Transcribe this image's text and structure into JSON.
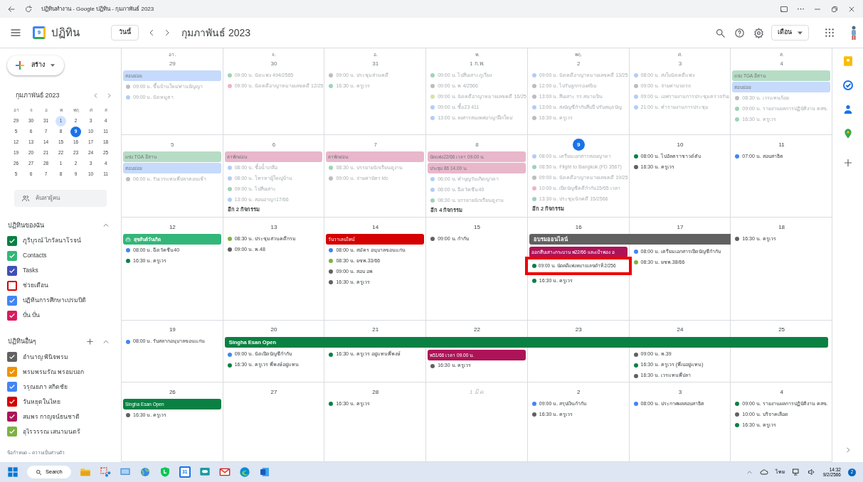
{
  "browser": {
    "title": "ปฏิทินทำงาน - Google ปฏิทิน - กุมภาพันธ์ 2023",
    "more": "···"
  },
  "header": {
    "logo_day": "9",
    "app_name": "ปฏิทิน",
    "today_button": "วันนี้",
    "month_title": "กุมภาพันธ์ 2023",
    "view_selector": "เดือน"
  },
  "sidebar": {
    "create_button": "สร้าง",
    "mini_calendar": {
      "title": "กุมภาพันธ์ 2023",
      "weekdays": [
        "อา",
        "จ",
        "อ",
        "พ",
        "พฤ",
        "ศ",
        "ส"
      ],
      "weeks": [
        [
          {
            "day": "29",
            "selected": false,
            "today": false
          },
          {
            "day": "30",
            "selected": false,
            "today": false
          },
          {
            "day": "31",
            "selected": false,
            "today": false
          },
          {
            "day": "1",
            "selected": true,
            "today": false
          },
          {
            "day": "2",
            "selected": false,
            "today": false
          },
          {
            "day": "3",
            "selected": false,
            "today": false
          },
          {
            "day": "4",
            "selected": false,
            "today": false
          }
        ],
        [
          {
            "day": "5",
            "selected": false,
            "today": false
          },
          {
            "day": "6",
            "selected": false,
            "today": false
          },
          {
            "day": "7",
            "selected": false,
            "today": false
          },
          {
            "day": "8",
            "selected": false,
            "today": false
          },
          {
            "day": "9",
            "selected": false,
            "today": true
          },
          {
            "day": "10",
            "selected": false,
            "today": false
          },
          {
            "day": "11",
            "selected": false,
            "today": false
          }
        ],
        [
          {
            "day": "12",
            "selected": false,
            "today": false
          },
          {
            "day": "13",
            "selected": false,
            "today": false
          },
          {
            "day": "14",
            "selected": false,
            "today": false
          },
          {
            "day": "15",
            "selected": false,
            "today": false
          },
          {
            "day": "16",
            "selected": false,
            "today": false
          },
          {
            "day": "17",
            "selected": false,
            "today": false
          },
          {
            "day": "18",
            "selected": false,
            "today": false
          }
        ],
        [
          {
            "day": "19",
            "selected": false,
            "today": false
          },
          {
            "day": "20",
            "selected": false,
            "today": false
          },
          {
            "day": "21",
            "selected": false,
            "today": false
          },
          {
            "day": "22",
            "selected": false,
            "today": false
          },
          {
            "day": "23",
            "selected": false,
            "today": false
          },
          {
            "day": "24",
            "selected": false,
            "today": false
          },
          {
            "day": "25",
            "selected": false,
            "today": false
          }
        ],
        [
          {
            "day": "26",
            "selected": false,
            "today": false
          },
          {
            "day": "27",
            "selected": false,
            "today": false
          },
          {
            "day": "28",
            "selected": false,
            "today": false
          },
          {
            "day": "1",
            "selected": false,
            "today": false
          },
          {
            "day": "2",
            "selected": false,
            "today": false
          },
          {
            "day": "3",
            "selected": false,
            "today": false
          },
          {
            "day": "4",
            "selected": false,
            "today": false
          }
        ],
        [
          {
            "day": "5",
            "selected": false,
            "today": false
          },
          {
            "day": "6",
            "selected": false,
            "today": false
          },
          {
            "day": "7",
            "selected": false,
            "today": false
          },
          {
            "day": "8",
            "selected": false,
            "today": false
          },
          {
            "day": "9",
            "selected": false,
            "today": false
          },
          {
            "day": "10",
            "selected": false,
            "today": false
          },
          {
            "day": "11",
            "selected": false,
            "today": false
          }
        ]
      ]
    },
    "search_people": {
      "placeholder": "ค้นหาผู้คน"
    },
    "my_calendars": {
      "title": "ปฏิทินของฉัน",
      "items": [
        {
          "name": "ภูริบุรณ์ ไกวัลนาโรจน์",
          "checked": true,
          "color": "#0b8043"
        },
        {
          "name": "Contacts",
          "checked": true,
          "color": "#33b679"
        },
        {
          "name": "Tasks",
          "checked": true,
          "color": "#3f51b5"
        },
        {
          "name": "ช่วยเตือน",
          "checked": false,
          "color": "#d50000"
        },
        {
          "name": "ปฏิทินการศึกษาเปรมปิติ",
          "checked": true,
          "color": "#4285f4"
        },
        {
          "name": "ปั่น ปั่น",
          "checked": true,
          "color": "#d81b60"
        }
      ]
    },
    "other_calendars": {
      "title": "ปฏิทินอื่นๆ",
      "items": [
        {
          "name": "อำนาญ พินิจพรม",
          "checked": true,
          "color": "#616161"
        },
        {
          "name": "พรมพรมรัณ พรอมบอก",
          "checked": true,
          "color": "#f09300"
        },
        {
          "name": "วรุณยภา สกิดชัย",
          "checked": true,
          "color": "#4285f4"
        },
        {
          "name": "วันหยุดในไทย",
          "checked": true,
          "color": "#d50000"
        },
        {
          "name": "สมพร กาญจน์ธนชาติ",
          "checked": true,
          "color": "#ad1457"
        },
        {
          "name": "อุไรวรรณ เสนามนตรี",
          "checked": true,
          "color": "#7cb342"
        }
      ]
    },
    "footer": "ข้อกำหนด – ความเป็นส่วนตัว"
  },
  "month_grid": {
    "weekday_labels": [
      "อา.",
      "จ.",
      "อ.",
      "พ.",
      "พฤ.",
      "ศ.",
      "ส."
    ],
    "weeks": [
      {
        "days": [
          {
            "label": "29",
            "past": true,
            "today": false,
            "other_month": false,
            "events": [
              {
                "kind": "chip",
                "title": "สอบย่อย",
                "color": "#c6dafc"
              },
              {
                "kind": "timed",
                "text": "09:00 น. ขึ้นบ้านใหม่ท่านปัญญา",
                "color": "#bdbdbd"
              },
              {
                "kind": "timed",
                "text": "09:00 น. นัดหมูตา",
                "color": "#b3cdf7"
              }
            ]
          },
          {
            "label": "30",
            "past": true,
            "today": false,
            "other_month": false,
            "events": [
              {
                "kind": "timed",
                "text": "09:00 น. นัดแพ่ง 494/2565",
                "color": "#9fd3b5"
              },
              {
                "kind": "timed",
                "text": "09:00 น. นัดคดีอาญาหมายเลขคดี 12/25",
                "color": "#efb3c8"
              }
            ]
          },
          {
            "label": "31",
            "past": true,
            "today": false,
            "other_month": false,
            "events": [
              {
                "kind": "timed",
                "text": "09:00 น. ประชุมส่วนคดี",
                "color": "#bdbdbd"
              },
              {
                "kind": "timed",
                "text": "16:30 น. ครูเวร",
                "color": "#9fd3b5"
              }
            ]
          },
          {
            "label": "1 ก.พ.",
            "past": true,
            "today": false,
            "other_month": false,
            "events": [
              {
                "kind": "timed",
                "text": "09:00 น. ไปสืบเสาะภูเวียง",
                "color": "#9fd3b5"
              },
              {
                "kind": "timed",
                "text": "09:00 น. พ 4/2566",
                "color": "#bdbdbd"
              },
              {
                "kind": "timed",
                "text": "09:00 น. นัดคดีอาญาหมายเลขคดี 16/25",
                "color": "#d4e3a8"
              },
              {
                "kind": "timed",
                "text": "09:00 น. ซื้อ23 411",
                "color": "#b3cdf7"
              },
              {
                "kind": "timed",
                "text": "13:00 น. ลงสารสนเทศอาญาฝึกใหม่",
                "color": "#b3cdf7"
              }
            ]
          },
          {
            "label": "2",
            "past": true,
            "today": false,
            "other_month": false,
            "events": [
              {
                "kind": "timed",
                "text": "09:00 น. นัดคดีอาญาหมายเลขคดี 13/25",
                "color": "#b3cdf7"
              },
              {
                "kind": "timed",
                "text": "12:00 น. ไปรับลูกกรองสนิม",
                "color": "#bdbdbd"
              },
              {
                "kind": "timed",
                "text": "13:00 น. สืบเสาะ รร.สนามบิน",
                "color": "#bdbdbd"
              },
              {
                "kind": "timed",
                "text": "13:00 น. ส่งบัญชีกำกับสืบปี ปรับสมุดบัญ",
                "color": "#b3cdf7"
              },
              {
                "kind": "timed",
                "text": "16:30 น. ครูเวร",
                "color": "#bdbdbd"
              }
            ]
          },
          {
            "label": "3",
            "past": true,
            "today": false,
            "other_month": false,
            "events": [
              {
                "kind": "timed",
                "text": "08:00 น. ส่งใบนัดคดีแพ่ง",
                "color": "#b3cdf7"
              },
              {
                "kind": "timed",
                "text": "09:00 น. จ่ายค่าบวดรถ",
                "color": "#bdbdbd"
              },
              {
                "kind": "timed",
                "text": "09:00 น. เอฟรายงานการประชุมตรวจรับเ",
                "color": "#b3cdf7"
              },
              {
                "kind": "timed",
                "text": "21:00 น. ทำรายงานการประชุม",
                "color": "#b3cdf7"
              }
            ]
          },
          {
            "label": "4",
            "past": true,
            "today": false,
            "other_month": false,
            "events": [
              {
                "kind": "chip",
                "title": "แข่ง TGA อีสาน",
                "color": "#b7dcc5"
              },
              {
                "kind": "chip",
                "title": "สอบย่อย",
                "color": "#c6dafc"
              },
              {
                "kind": "timed",
                "text": "08:30 น. เวรแทนก้อย",
                "color": "#bdbdbd"
              },
              {
                "kind": "timed",
                "text": "09:00 น. รายงานผลการปฏิบัติงาน คสข.",
                "color": "#9fd3b5"
              },
              {
                "kind": "timed",
                "text": "16:30 น. ครูเวร",
                "color": "#9fd3b5"
              }
            ]
          }
        ]
      },
      {
        "days": [
          {
            "label": "5",
            "past": true,
            "today": false,
            "other_month": false,
            "events": [
              {
                "kind": "chip",
                "title": "แข่ง TGA อีสาน",
                "color": "#b7dcc5"
              },
              {
                "kind": "chip",
                "title": "สอบย่อย",
                "color": "#c6dafc"
              },
              {
                "kind": "timed",
                "text": "06:00 น. รับเวรแทนพี่ปลาตอนเช้า",
                "color": "#bdbdbd"
              }
            ]
          },
          {
            "label": "6",
            "past": true,
            "today": false,
            "other_month": false,
            "more": "อีก 2 กิจกรรม",
            "events": [
              {
                "kind": "chip",
                "title": "ลาพักผ่อน",
                "color": "#e8b7cb"
              },
              {
                "kind": "timed",
                "text": "08:00 น. ซื้อน้ำเกลือ",
                "color": "#b3cdf7"
              },
              {
                "kind": "timed",
                "text": "08:00 น. โทรหาผู้ใหญ่บ้าน",
                "color": "#b3cdf7"
              },
              {
                "kind": "timed",
                "text": "09:00 น. ไปสืบเสาะ",
                "color": "#9fd3b5"
              },
              {
                "kind": "timed",
                "text": "13:00 น. สอบอาญา17/66",
                "color": "#b3cdf7"
              }
            ]
          },
          {
            "label": "7",
            "past": true,
            "today": false,
            "other_month": false,
            "events": [
              {
                "kind": "chip",
                "title": "ลาพักผ่อน",
                "color": "#e8b7cb"
              },
              {
                "kind": "timed",
                "text": "08:30 น. บรรยายนักเรียนดูงาน",
                "color": "#9fd3b5"
              },
              {
                "kind": "timed",
                "text": "09:00 น. จ่ายค่าบัตร ktc",
                "color": "#bdbdbd"
              }
            ]
          },
          {
            "label": "8",
            "past": true,
            "today": false,
            "other_month": false,
            "more": "อีก 4 กิจกรรม",
            "events": [
              {
                "kind": "chip",
                "title": "นัดแพ่ง22/66 เวลา 09.00 น.",
                "color": "#e8b7cb"
              },
              {
                "kind": "chip",
                "title": "ประชุม 86 14.00 น.",
                "color": "#e8b7cb"
              },
              {
                "kind": "timed",
                "text": "06:00 น. ทำบุญวันเกิดญาดา",
                "color": "#b3cdf7"
              },
              {
                "kind": "timed",
                "text": "08:00 น. ฉีดวัคซีน40",
                "color": "#b3cdf7"
              },
              {
                "kind": "timed",
                "text": "08:30 น. บรรยายนักเรียนดูงาน",
                "color": "#9fd3b5"
              }
            ]
          },
          {
            "label": "9",
            "past": false,
            "today": true,
            "other_month": false,
            "more": "อีก 2 กิจกรรม",
            "events": [
              {
                "kind": "done",
                "text": "08:00 น. เตรียมเอกสารสอบญาดา",
                "color": "#b3cdf7"
              },
              {
                "kind": "done",
                "text": "08:50 น. Flight to Bangkok (FD 3567)",
                "color": "#9fd3b5"
              },
              {
                "kind": "done",
                "text": "09:00 น. นัดคดีอาญาหมายเลขคดี 19/25",
                "color": "#bdbdbd"
              },
              {
                "kind": "done",
                "text": "10:00 น. เปิดบัญชีคดีกำกับ15/65 เวลา",
                "color": "#efb3c8"
              },
              {
                "kind": "done",
                "text": "13:30 น. ประชุมนักคดี 15/2566",
                "color": "#9fd3b5"
              }
            ]
          },
          {
            "label": "10",
            "past": false,
            "today": false,
            "other_month": false,
            "events": [
              {
                "kind": "timed",
                "text": "08:00 น. ไปอัลตราซาวด์ตับ",
                "color": "#0b8043"
              },
              {
                "kind": "timed",
                "text": "16:30 น. ครูเวร",
                "color": "#616161"
              }
            ]
          },
          {
            "label": "11",
            "past": false,
            "today": false,
            "other_month": false,
            "events": [
              {
                "kind": "timed",
                "text": "07:00 น. สอบสาธิต",
                "color": "#4285f4"
              }
            ]
          }
        ]
      },
      {
        "days": [
          {
            "label": "12",
            "past": false,
            "today": false,
            "other_month": false,
            "events": [
              {
                "kind": "birthday",
                "title": "สุขสันต์วันเกิด",
                "color": "#33b679"
              },
              {
                "kind": "timed",
                "text": "08:00 น. ฉีดวัคซีน40",
                "color": "#4285f4"
              },
              {
                "kind": "timed",
                "text": "16:30 น. ครูเวร",
                "color": "#0b8043"
              }
            ]
          },
          {
            "label": "13",
            "past": false,
            "today": false,
            "other_month": false,
            "events": [
              {
                "kind": "timed",
                "text": "08:30 น. ประชุมส่วนคดีกรม",
                "color": "#7cb342"
              },
              {
                "kind": "timed",
                "text": "09:00 น. พ.48",
                "color": "#616161"
              }
            ]
          },
          {
            "label": "14",
            "past": false,
            "today": false,
            "other_month": false,
            "events": [
              {
                "kind": "chip",
                "title": "วันวาเลนไทน์",
                "color": "#d50000"
              },
              {
                "kind": "timed",
                "text": "08:00 น. สมัคร อนุบาลขอนแก่น",
                "color": "#4285f4"
              },
              {
                "kind": "timed",
                "text": "08:30 น. ยชพ.33/66",
                "color": "#7cb342"
              },
              {
                "kind": "timed",
                "text": "09:00 น. สอบ อพ",
                "color": "#616161"
              },
              {
                "kind": "timed",
                "text": "16:30 น. ครูเวร",
                "color": "#616161"
              }
            ]
          },
          {
            "label": "15",
            "past": false,
            "today": false,
            "other_month": false,
            "events": [
              {
                "kind": "timed",
                "text": "09:00 น. กำกับ",
                "color": "#616161"
              }
            ]
          },
          {
            "label": "16",
            "past": false,
            "today": false,
            "other_month": false,
            "events": [
              {
                "kind": "span_start",
                "title": "อบรมออนไลน์",
                "color": "#616161"
              },
              {
                "kind": "chip",
                "title": "ออกสืบเสาะกระบวน พ22/66 และเป้าพอง อ",
                "color": "#ad1457"
              },
              {
                "kind": "highlighted",
                "text": "09:00 น. นัดคดีแพ่งหมายเลขดำที่ 2/256",
                "color": "#0b8043"
              },
              {
                "kind": "timed",
                "text": "16:30 น. ครูเวร",
                "color": "#0b8043"
              }
            ]
          },
          {
            "label": "17",
            "past": false,
            "today": false,
            "other_month": false,
            "events": [
              {
                "kind": "span_continue",
                "color": "#616161"
              },
              {
                "kind": "timed",
                "text": "08:00 น. เตรียมเอกสารเปิดบัญชีกำกับ",
                "color": "#4285f4"
              },
              {
                "kind": "timed",
                "text": "08:30 น. ยชพ.38/66",
                "color": "#7cb342"
              }
            ]
          },
          {
            "label": "18",
            "past": false,
            "today": false,
            "other_month": false,
            "events": [
              {
                "kind": "timed",
                "text": "16:30 น. ครูเวร",
                "color": "#616161"
              }
            ]
          }
        ]
      },
      {
        "days": [
          {
            "label": "19",
            "past": false,
            "today": false,
            "other_month": false,
            "events": [
              {
                "kind": "timed",
                "text": "08:00 น. รับสลากอนุบาลขอนแก่น",
                "color": "#4285f4"
              }
            ]
          },
          {
            "label": "20",
            "past": false,
            "today": false,
            "other_month": false,
            "events": [
              {
                "kind": "span_start",
                "title": "Singha Esan Open",
                "color": "#0b8043"
              },
              {
                "kind": "timed",
                "text": "09:00 น. นัดเปิดบัญชีกำกับ",
                "color": "#4285f4"
              },
              {
                "kind": "timed",
                "text": "16:30 น. ครูเวร พี่พงษ์อยู่แทน",
                "color": "#0b8043"
              }
            ]
          },
          {
            "label": "21",
            "past": false,
            "today": false,
            "other_month": false,
            "events": [
              {
                "kind": "span_continue",
                "color": "#0b8043"
              },
              {
                "kind": "timed",
                "text": "16:30 น. ครูเวร อยู่แทนพี่พงษ์",
                "color": "#0b8043"
              }
            ]
          },
          {
            "label": "22",
            "past": false,
            "today": false,
            "other_month": false,
            "events": [
              {
                "kind": "span_continue",
                "color": "#0b8043"
              },
              {
                "kind": "chip",
                "title": "พ51/66 เวลา 09.00 น.",
                "color": "#ad1457"
              },
              {
                "kind": "timed",
                "text": "16:30 น. ครูเวร",
                "color": "#616161"
              }
            ]
          },
          {
            "label": "23",
            "past": false,
            "today": false,
            "other_month": false,
            "events": [
              {
                "kind": "span_continue",
                "color": "#0b8043"
              }
            ]
          },
          {
            "label": "24",
            "past": false,
            "today": false,
            "other_month": false,
            "events": [
              {
                "kind": "span_continue",
                "color": "#0b8043"
              },
              {
                "kind": "timed",
                "text": "09:00 น. พ.39",
                "color": "#616161"
              },
              {
                "kind": "timed",
                "text": "16:30 น. ครูเวร (พี่เบอยู่แทน)",
                "color": "#0b8043"
              },
              {
                "kind": "timed",
                "text": "16:30 น. เวรแทนพี่ปลา",
                "color": "#616161"
              }
            ]
          },
          {
            "label": "25",
            "past": false,
            "today": false,
            "other_month": false,
            "events": [
              {
                "kind": "span_end",
                "color": "#0b8043"
              }
            ]
          }
        ]
      },
      {
        "days": [
          {
            "label": "26",
            "past": false,
            "today": false,
            "other_month": false,
            "events": [
              {
                "kind": "chip",
                "title": "Singha Esan Open",
                "color": "#0b8043"
              },
              {
                "kind": "timed",
                "text": "16:30 น. ครูเวร",
                "color": "#616161"
              }
            ]
          },
          {
            "label": "27",
            "past": false,
            "today": false,
            "other_month": false
          },
          {
            "label": "28",
            "past": false,
            "today": false,
            "other_month": false,
            "events": [
              {
                "kind": "timed",
                "text": "16:30 น. ครูเวร",
                "color": "#0b8043"
              }
            ]
          },
          {
            "label": "1 มี.ค.",
            "past": false,
            "today": false,
            "other_month": true
          },
          {
            "label": "2",
            "past": false,
            "today": false,
            "other_month": false,
            "events": [
              {
                "kind": "timed",
                "text": "09:00 น. สรุปเงินกำกับ",
                "color": "#4285f4"
              },
              {
                "kind": "timed",
                "text": "16:30 น. ครูเวร",
                "color": "#616161"
              }
            ]
          },
          {
            "label": "3",
            "past": false,
            "today": false,
            "other_month": false,
            "events": [
              {
                "kind": "timed",
                "text": "08:00 น. ประกาศผลสอบสาธิต",
                "color": "#4285f4"
              }
            ]
          },
          {
            "label": "4",
            "past": false,
            "today": false,
            "other_month": false,
            "events": [
              {
                "kind": "timed",
                "text": "09:00 น. รายงานผลการปฏิบัติงาน คสข.",
                "color": "#0b8043"
              },
              {
                "kind": "timed",
                "text": "10:00 น. บริจาคเลือด",
                "color": "#616161"
              },
              {
                "kind": "timed",
                "text": "16:30 น. ครูเวร",
                "color": "#0b8043"
              }
            ]
          }
        ]
      }
    ]
  },
  "taskbar": {
    "search": "Search",
    "calendar_day": "31",
    "language": "ไทย",
    "time": "14:32",
    "date": "9/2/2566",
    "notifications": "2"
  }
}
